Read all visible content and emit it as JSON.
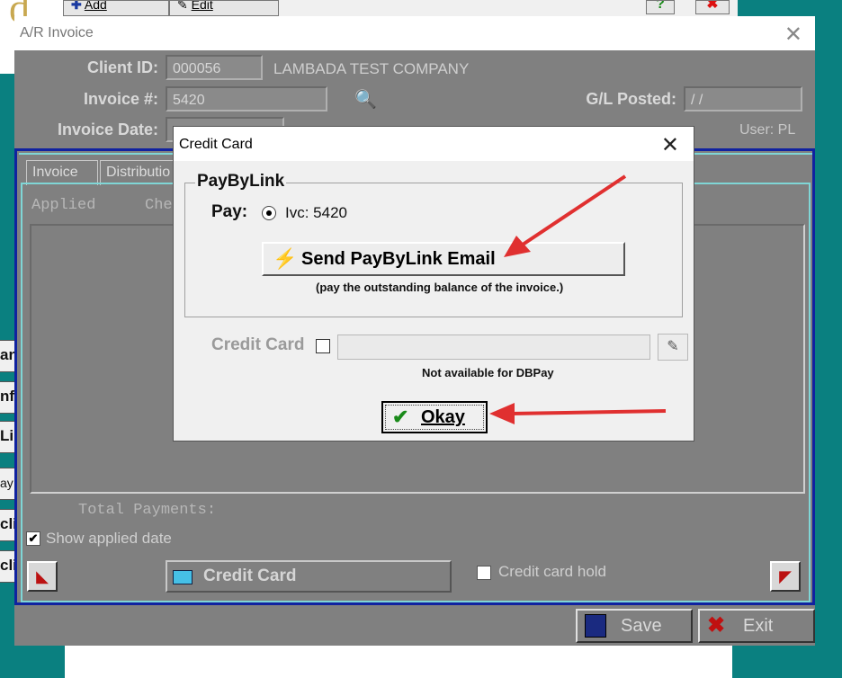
{
  "background_app": {
    "add_label": "Add",
    "edit_label": "Edit",
    "help_glyph": "?",
    "side_buttons": [
      "an",
      "nf",
      "Li",
      "ay",
      "cli",
      "cli"
    ]
  },
  "invoice_window": {
    "title": "A/R Invoice",
    "client_id_label": "Client ID:",
    "client_id_value": "000056",
    "client_name": "LAMBADA  TEST COMPANY",
    "invoice_no_label": "Invoice #:",
    "invoice_no_value": "5420",
    "gl_posted_label": "G/L Posted:",
    "gl_posted_value": "/ /",
    "invoice_date_label": "Invoice Date:",
    "user_label": "User: PL",
    "tabs": [
      "Invoice",
      "Distributio"
    ],
    "grid_headers": [
      "Applied",
      "Che"
    ],
    "total_payments_label": "Total Payments:",
    "show_applied_date_label": "Show applied date",
    "credit_card_button": "Credit Card",
    "credit_card_hold_label": "Credit card hold",
    "save_label": "Save",
    "exit_label": "Exit"
  },
  "dialog": {
    "title": "Credit Card",
    "group_title": "PayByLink",
    "pay_label": "Pay:",
    "pay_option": "Ivc: 5420",
    "send_button": "Send PayByLink Email",
    "send_note": "(pay the outstanding balance of the invoice.)",
    "credit_card_label": "Credit Card",
    "not_available_note": "Not available for DBPay",
    "okay_label": "Okay"
  },
  "colors": {
    "arrow": "#e03030",
    "window_gray": "#808080",
    "desktop_teal": "#0a8080"
  }
}
